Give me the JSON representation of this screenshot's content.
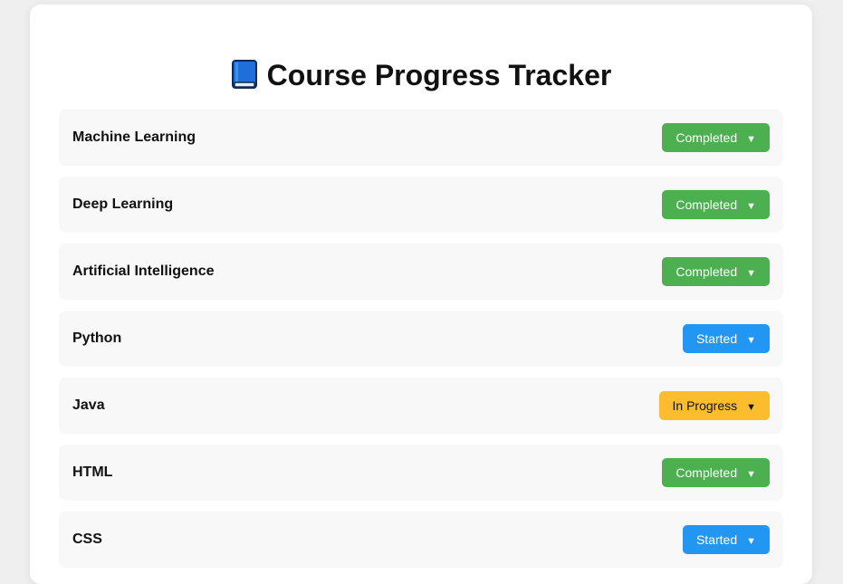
{
  "page": {
    "title": "Course Progress Tracker",
    "title_icon": "book-icon"
  },
  "colors": {
    "Completed": "#4caf50",
    "Started": "#2196f3",
    "In Progress": "#fbbd2e"
  },
  "courses": [
    {
      "name": "Machine Learning",
      "status": "Completed"
    },
    {
      "name": "Deep Learning",
      "status": "Completed"
    },
    {
      "name": "Artificial Intelligence",
      "status": "Completed"
    },
    {
      "name": "Python",
      "status": "Started"
    },
    {
      "name": "Java",
      "status": "In Progress"
    },
    {
      "name": "HTML",
      "status": "Completed"
    },
    {
      "name": "CSS",
      "status": "Started"
    }
  ],
  "dropdown_caret": "▼"
}
